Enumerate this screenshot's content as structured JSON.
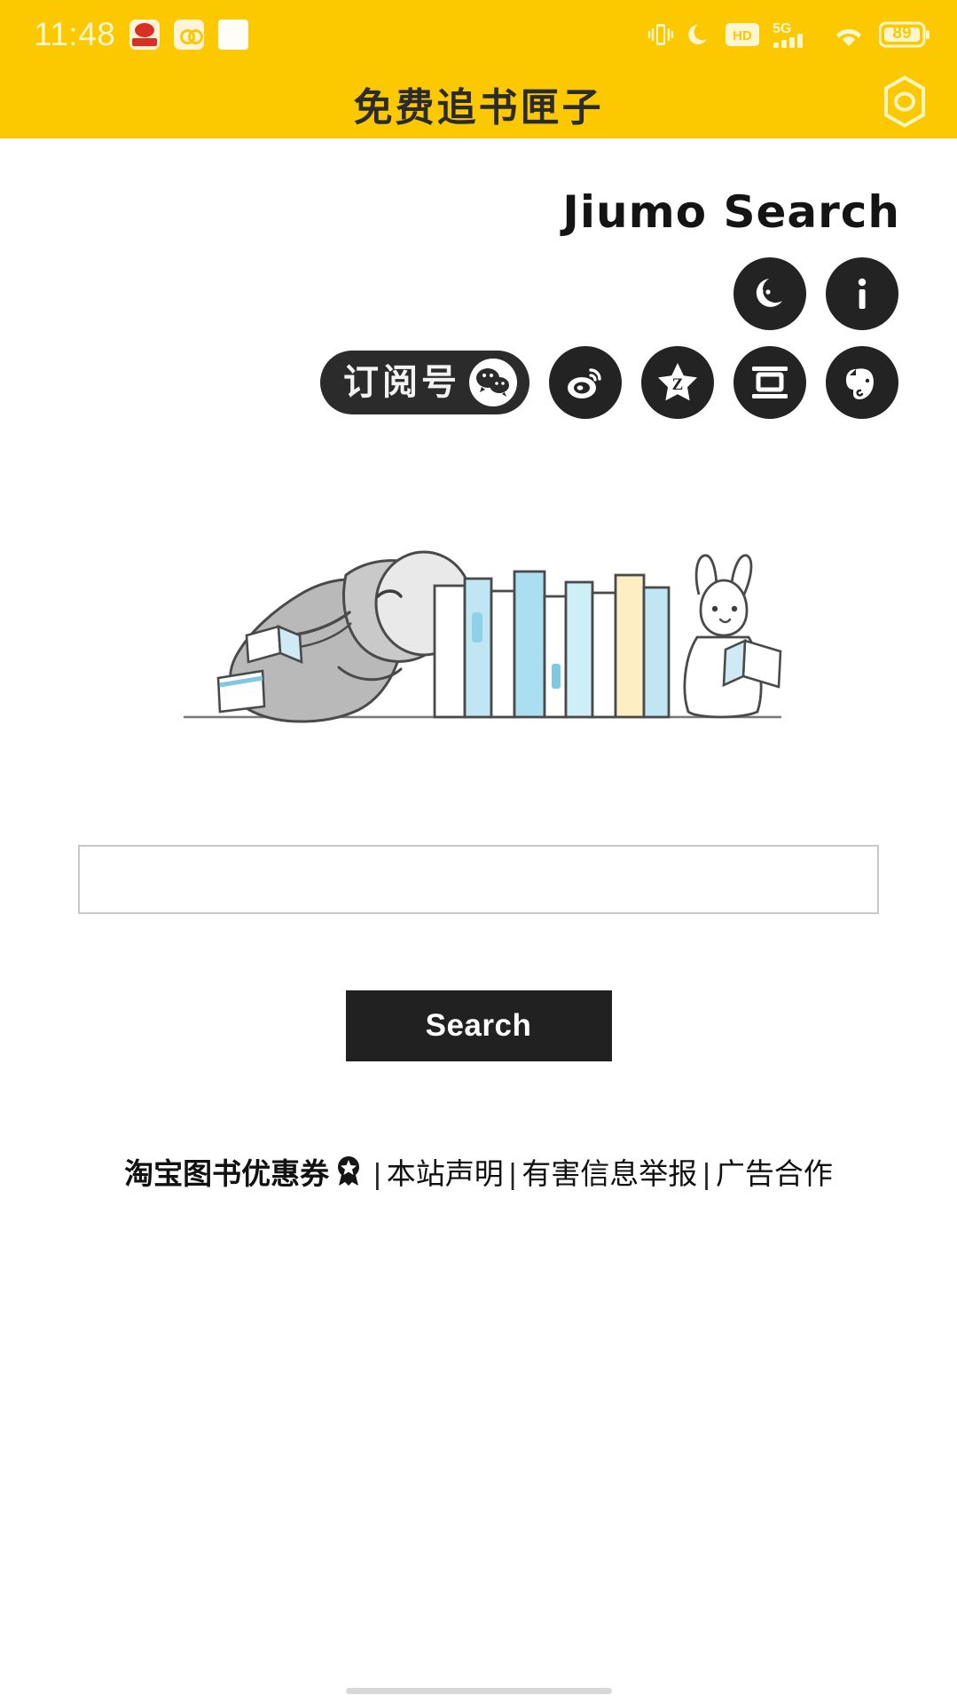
{
  "status_bar": {
    "time": "11:48",
    "left_icons": [
      {
        "name": "red-packet-app-icon"
      },
      {
        "name": "cloud-app-icon"
      },
      {
        "name": "blank-app-icon"
      }
    ],
    "right_icons": [
      {
        "name": "vibrate-icon"
      },
      {
        "name": "do-not-disturb-moon-icon"
      },
      {
        "name": "hd-icon",
        "label": "HD"
      },
      {
        "name": "signal-5g-icon",
        "label": "5G"
      },
      {
        "name": "wifi-icon"
      },
      {
        "name": "battery-icon",
        "label": "89"
      }
    ]
  },
  "app_header": {
    "title": "免费追书匣子",
    "action_icon": "hexagon-target-icon",
    "background": "#FCC800"
  },
  "brand": {
    "logo_text": "Jiumo Search"
  },
  "icon_row_primary": [
    {
      "name": "night-mode-icon",
      "label": "夜间模式"
    },
    {
      "name": "info-icon",
      "label": "关于"
    }
  ],
  "icon_row_social": [
    {
      "name": "wechat-subscription-pill",
      "label": "订阅号",
      "badge_icon": "wechat-icon"
    },
    {
      "name": "weibo-icon",
      "label": "微博"
    },
    {
      "name": "zhihu-icon",
      "label": "知乎"
    },
    {
      "name": "douban-icon",
      "label": "豆瓣"
    },
    {
      "name": "evernote-icon",
      "label": "印象笔记"
    }
  ],
  "illustration": {
    "name": "elephant-rabbit-reading-books-illustration"
  },
  "search": {
    "value": "",
    "placeholder": "",
    "button_label": "Search"
  },
  "footer": {
    "taobao_coupon": "淘宝图书优惠券",
    "medal_icon": "medal-icon",
    "sep": "|",
    "links": [
      "本站声明",
      "有害信息举报",
      "广告合作"
    ]
  },
  "colors": {
    "brand_yellow": "#FCC800",
    "dark": "#212121",
    "status_text": "#FFF6D0"
  }
}
